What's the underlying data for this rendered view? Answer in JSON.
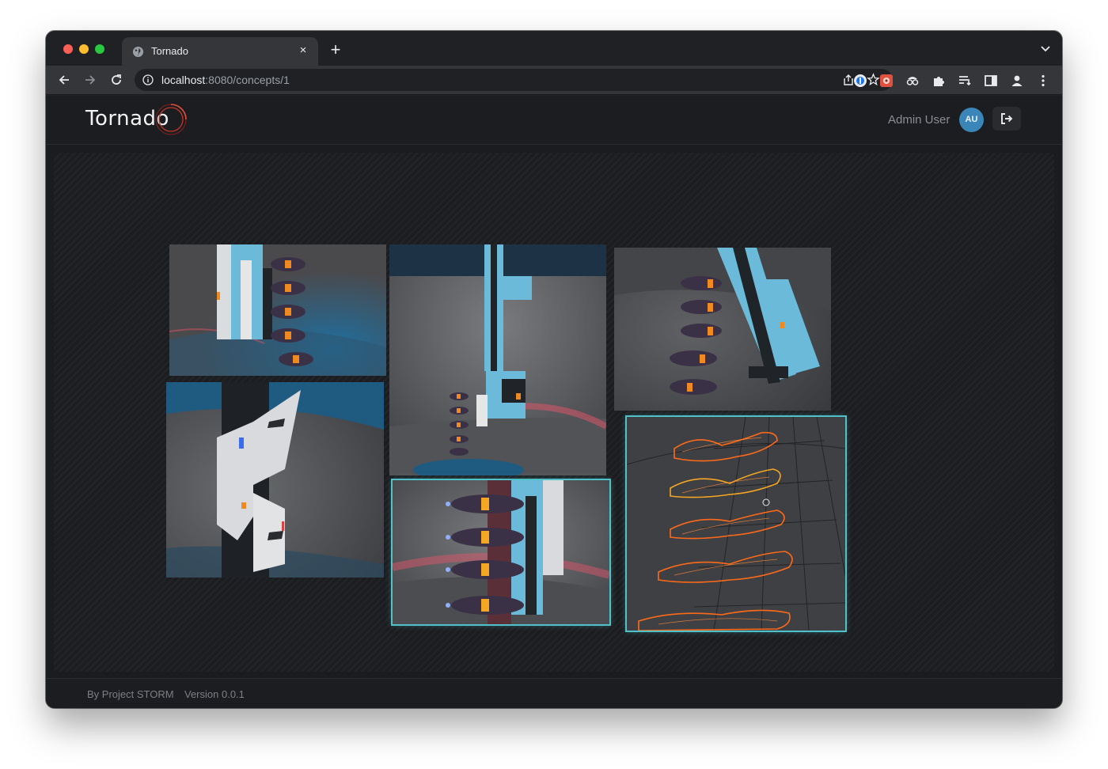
{
  "browser": {
    "tab_title": "Tornado",
    "close_glyph": "×",
    "new_tab_glyph": "+",
    "url_host": "localhost",
    "url_rest": ":8080/concepts/1"
  },
  "header": {
    "logo_text": "Tornado",
    "user_name": "Admin User",
    "avatar_initials": "AU",
    "accent": "#c0392b"
  },
  "board": {
    "images": [
      {
        "id": "concept-1",
        "selected": false
      },
      {
        "id": "concept-2",
        "selected": false
      },
      {
        "id": "concept-3",
        "selected": false
      },
      {
        "id": "concept-4",
        "selected": false
      },
      {
        "id": "concept-5",
        "selected": true
      },
      {
        "id": "concept-6",
        "selected": true
      }
    ],
    "selection_color": "#4fc2c9"
  },
  "footer": {
    "by": "By Project STORM",
    "version": "Version 0.0.1"
  }
}
